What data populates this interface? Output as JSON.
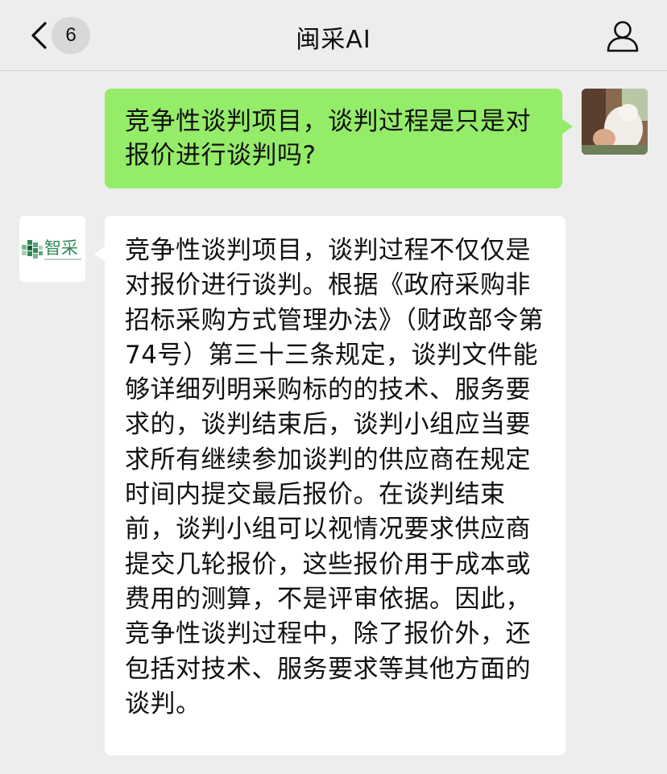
{
  "header": {
    "back_icon": "chevron-left-icon",
    "unread_count": "6",
    "title": "闽采AI",
    "profile_icon": "person-icon"
  },
  "messages": [
    {
      "sender": "user",
      "text": "竞争性谈判项目，谈判过程是只是对报价进行谈判吗?"
    },
    {
      "sender": "bot",
      "avatar_text": "智采",
      "text": "竞争性谈判项目，谈判过程不仅仅是对报价进行谈判。根据《政府采购非招标采购方式管理办法》（财政部令第74号）第三十三条规定，谈判文件能够详细列明采购标的的技术、服务要求的，谈判结束后，谈判小组应当要求所有继续参加谈判的供应商在规定时间内提交最后报价。在谈判结束前，谈判小组可以视情况要求供应商提交几轮报价，这些报价用于成本或费用的测算，不是评审依据。因此，竞争性谈判过程中，除了报价外，还包括对技术、服务要求等其他方面的谈判。"
    }
  ],
  "colors": {
    "background": "#ededed",
    "user_bubble": "#95ec69",
    "bot_bubble": "#ffffff",
    "logo_green": "#2e8b57"
  }
}
